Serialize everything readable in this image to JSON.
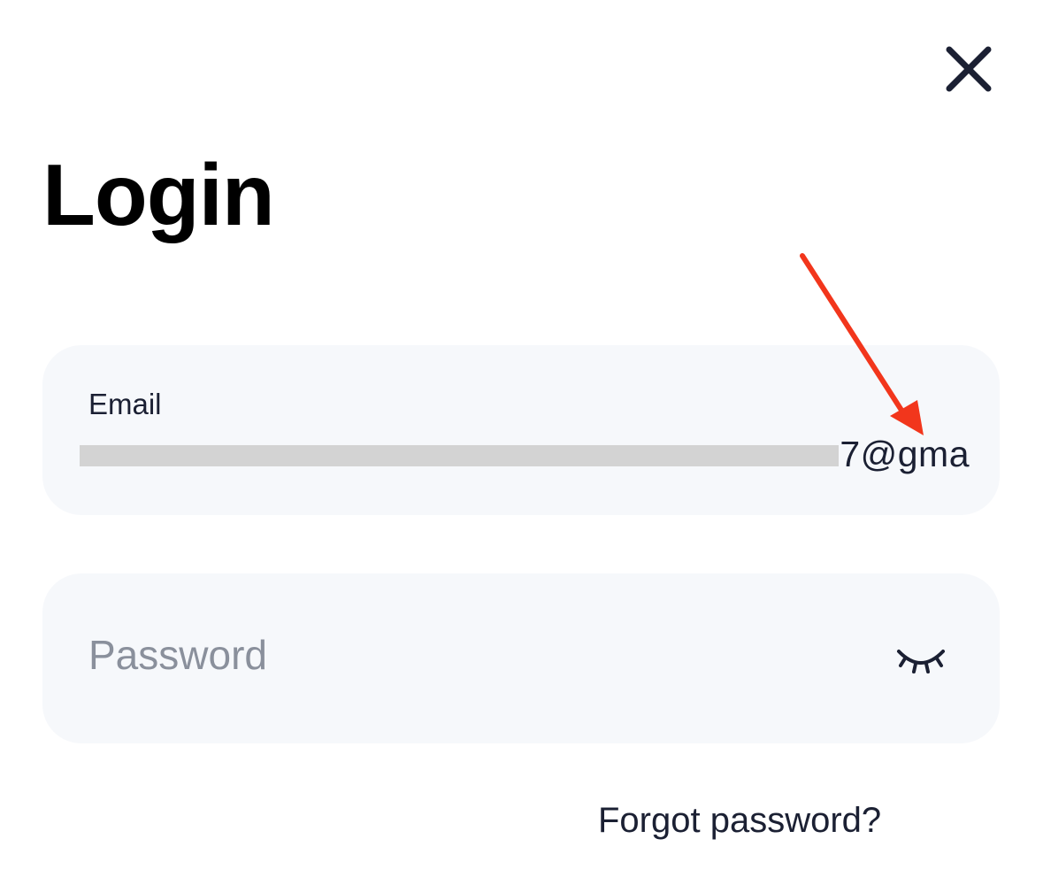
{
  "header": {
    "close_icon": "close-icon"
  },
  "page": {
    "title": "Login"
  },
  "email": {
    "label": "Email",
    "visible_value": "7@gma",
    "redacted": true
  },
  "password": {
    "placeholder": "Password",
    "toggle_icon": "eye-closed-icon"
  },
  "links": {
    "forgot_password": "Forgot password?"
  },
  "colors": {
    "text_primary": "#1b2033",
    "field_background": "#f6f8fb",
    "placeholder": "#8a909c",
    "annotation_arrow": "#f2361c"
  }
}
